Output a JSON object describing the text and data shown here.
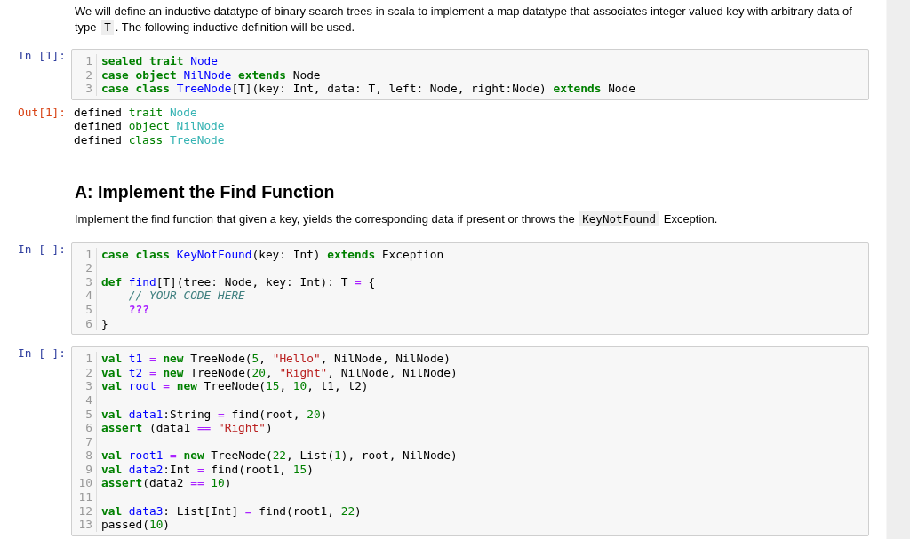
{
  "cells": [
    {
      "kind": "markdown",
      "selected": true,
      "paragraphs": [
        [
          {
            "text": "We will define an inductive datatype of binary search trees in scala to implement a map datatype that associates integer valued key with arbitrary data of type ",
            "code": false
          },
          {
            "text": "T",
            "code": true
          },
          {
            "text": ". The following inductive definition will be used.",
            "code": false
          }
        ]
      ]
    },
    {
      "kind": "code",
      "selected": false,
      "prompt": "In [1]:",
      "lines": [
        {
          "number": "1",
          "tokens": [
            {
              "kind": "keyword",
              "text": "sealed trait "
            },
            {
              "kind": "name",
              "text": "Node"
            }
          ]
        },
        {
          "number": "2",
          "tokens": [
            {
              "kind": "keyword",
              "text": "case object "
            },
            {
              "kind": "name",
              "text": "NilNode "
            },
            {
              "kind": "keyword",
              "text": "extends "
            },
            {
              "kind": "plain",
              "text": "Node"
            }
          ]
        },
        {
          "number": "3",
          "tokens": [
            {
              "kind": "keyword",
              "text": "case class "
            },
            {
              "kind": "name",
              "text": "TreeNode"
            },
            {
              "kind": "plain",
              "text": "[T](key: Int, data: T, left: Node, right:Node) "
            },
            {
              "kind": "keyword",
              "text": "extends "
            },
            {
              "kind": "plain",
              "text": "Node"
            }
          ]
        }
      ],
      "output": {
        "prompt": "Out[1]:",
        "lines": [
          [
            {
              "kind": "plain",
              "text": "defined "
            },
            {
              "kind": "out_keyword",
              "text": "trait "
            },
            {
              "kind": "out_name",
              "text": "Node"
            }
          ],
          [
            {
              "kind": "plain",
              "text": "defined "
            },
            {
              "kind": "out_keyword",
              "text": "object "
            },
            {
              "kind": "out_name",
              "text": "NilNode"
            }
          ],
          [
            {
              "kind": "plain",
              "text": "defined "
            },
            {
              "kind": "out_keyword",
              "text": "class "
            },
            {
              "kind": "out_name",
              "text": "TreeNode"
            }
          ]
        ]
      }
    },
    {
      "kind": "markdown",
      "selected": false,
      "heading": "A: Implement the Find Function",
      "paragraphs": [
        [
          {
            "text": "Implement the find function that given a key, yields the corresponding data if present or throws the ",
            "code": false
          },
          {
            "text": "KeyNotFound",
            "code": true
          },
          {
            "text": " Exception.",
            "code": false
          }
        ]
      ]
    },
    {
      "kind": "code",
      "selected": false,
      "prompt": "In [ ]:",
      "lines": [
        {
          "number": "1",
          "tokens": [
            {
              "kind": "keyword",
              "text": "case class "
            },
            {
              "kind": "name",
              "text": "KeyNotFound"
            },
            {
              "kind": "plain",
              "text": "(key: Int) "
            },
            {
              "kind": "keyword",
              "text": "extends "
            },
            {
              "kind": "plain",
              "text": "Exception"
            }
          ]
        },
        {
          "number": "2"
        },
        {
          "number": "3",
          "tokens": [
            {
              "kind": "keyword",
              "text": "def "
            },
            {
              "kind": "name",
              "text": "find"
            },
            {
              "kind": "plain",
              "text": "[T](tree: Node, key: Int): T "
            },
            {
              "kind": "operator",
              "text": "="
            },
            {
              "kind": "plain",
              "text": " {"
            }
          ]
        },
        {
          "number": "4",
          "tokens": [
            {
              "kind": "comment",
              "text": "    // YOUR CODE HERE"
            }
          ]
        },
        {
          "number": "5",
          "tokens": [
            {
              "kind": "special",
              "text": "    ???"
            }
          ]
        },
        {
          "number": "6",
          "tokens": [
            {
              "kind": "plain",
              "text": "}"
            }
          ]
        }
      ]
    },
    {
      "kind": "code",
      "selected": false,
      "prompt": "In [ ]:",
      "lines": [
        {
          "number": "1",
          "tokens": [
            {
              "kind": "keyword",
              "text": "val "
            },
            {
              "kind": "name",
              "text": "t1 "
            },
            {
              "kind": "operator",
              "text": "= "
            },
            {
              "kind": "keyword",
              "text": "new "
            },
            {
              "kind": "plain",
              "text": "TreeNode("
            },
            {
              "kind": "number",
              "text": "5"
            },
            {
              "kind": "plain",
              "text": ", "
            },
            {
              "kind": "string",
              "text": "\"Hello\""
            },
            {
              "kind": "plain",
              "text": ", NilNode, NilNode)"
            }
          ]
        },
        {
          "number": "2",
          "tokens": [
            {
              "kind": "keyword",
              "text": "val "
            },
            {
              "kind": "name",
              "text": "t2 "
            },
            {
              "kind": "operator",
              "text": "= "
            },
            {
              "kind": "keyword",
              "text": "new "
            },
            {
              "kind": "plain",
              "text": "TreeNode("
            },
            {
              "kind": "number",
              "text": "20"
            },
            {
              "kind": "plain",
              "text": ", "
            },
            {
              "kind": "string",
              "text": "\"Right\""
            },
            {
              "kind": "plain",
              "text": ", NilNode, NilNode)"
            }
          ]
        },
        {
          "number": "3",
          "tokens": [
            {
              "kind": "keyword",
              "text": "val "
            },
            {
              "kind": "name",
              "text": "root "
            },
            {
              "kind": "operator",
              "text": "= "
            },
            {
              "kind": "keyword",
              "text": "new "
            },
            {
              "kind": "plain",
              "text": "TreeNode("
            },
            {
              "kind": "number",
              "text": "15"
            },
            {
              "kind": "plain",
              "text": ", "
            },
            {
              "kind": "number",
              "text": "10"
            },
            {
              "kind": "plain",
              "text": ", t1, t2)"
            }
          ]
        },
        {
          "number": "4"
        },
        {
          "number": "5",
          "tokens": [
            {
              "kind": "keyword",
              "text": "val "
            },
            {
              "kind": "name",
              "text": "data1"
            },
            {
              "kind": "plain",
              "text": ":String "
            },
            {
              "kind": "operator",
              "text": "= "
            },
            {
              "kind": "plain",
              "text": "find(root, "
            },
            {
              "kind": "number",
              "text": "20"
            },
            {
              "kind": "plain",
              "text": ")"
            }
          ]
        },
        {
          "number": "6",
          "tokens": [
            {
              "kind": "keyword",
              "text": "assert "
            },
            {
              "kind": "plain",
              "text": "(data1 "
            },
            {
              "kind": "operator",
              "text": "== "
            },
            {
              "kind": "string",
              "text": "\"Right\""
            },
            {
              "kind": "plain",
              "text": ")"
            }
          ]
        },
        {
          "number": "7"
        },
        {
          "number": "8",
          "tokens": [
            {
              "kind": "keyword",
              "text": "val "
            },
            {
              "kind": "name",
              "text": "root1 "
            },
            {
              "kind": "operator",
              "text": "= "
            },
            {
              "kind": "keyword",
              "text": "new "
            },
            {
              "kind": "plain",
              "text": "TreeNode("
            },
            {
              "kind": "number",
              "text": "22"
            },
            {
              "kind": "plain",
              "text": ", List("
            },
            {
              "kind": "number",
              "text": "1"
            },
            {
              "kind": "plain",
              "text": "), root, NilNode)"
            }
          ]
        },
        {
          "number": "9",
          "tokens": [
            {
              "kind": "keyword",
              "text": "val "
            },
            {
              "kind": "name",
              "text": "data2"
            },
            {
              "kind": "plain",
              "text": ":Int "
            },
            {
              "kind": "operator",
              "text": "= "
            },
            {
              "kind": "plain",
              "text": "find(root1, "
            },
            {
              "kind": "number",
              "text": "15"
            },
            {
              "kind": "plain",
              "text": ")"
            }
          ]
        },
        {
          "number": "10",
          "tokens": [
            {
              "kind": "keyword",
              "text": "assert"
            },
            {
              "kind": "plain",
              "text": "(data2 "
            },
            {
              "kind": "operator",
              "text": "== "
            },
            {
              "kind": "number",
              "text": "10"
            },
            {
              "kind": "plain",
              "text": ")"
            }
          ]
        },
        {
          "number": "11"
        },
        {
          "number": "12",
          "tokens": [
            {
              "kind": "keyword",
              "text": "val "
            },
            {
              "kind": "name",
              "text": "data3"
            },
            {
              "kind": "plain",
              "text": ": List[Int] "
            },
            {
              "kind": "operator",
              "text": "= "
            },
            {
              "kind": "plain",
              "text": "find(root1, "
            },
            {
              "kind": "number",
              "text": "22"
            },
            {
              "kind": "plain",
              "text": ")"
            }
          ]
        },
        {
          "number": "13",
          "tokens": [
            {
              "kind": "plain",
              "text": "passed("
            },
            {
              "kind": "number",
              "text": "10"
            },
            {
              "kind": "plain",
              "text": ")"
            }
          ]
        }
      ]
    }
  ]
}
